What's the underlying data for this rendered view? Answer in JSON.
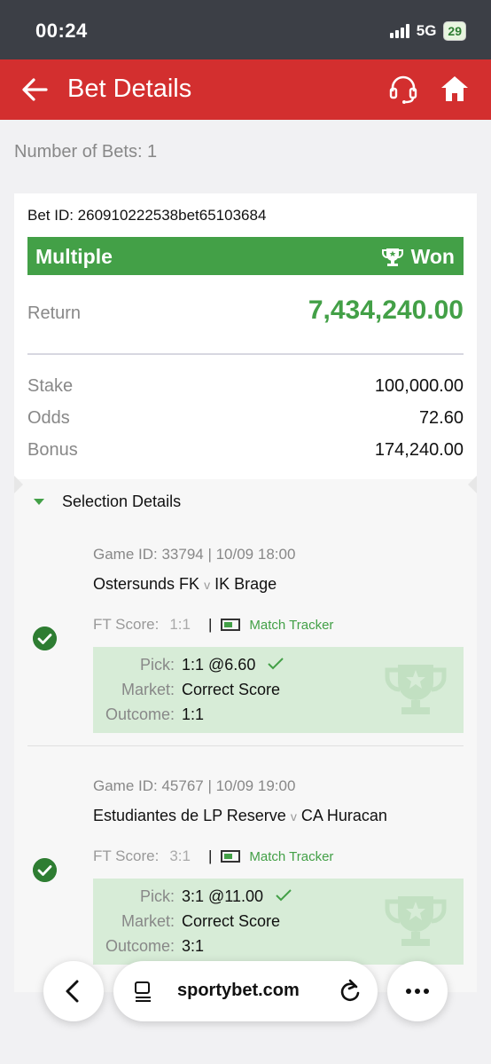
{
  "status_bar": {
    "time": "00:24",
    "network": "5G",
    "battery": "29"
  },
  "header": {
    "title": "Bet Details"
  },
  "summary": {
    "number_of_bets": "Number of Bets: 1"
  },
  "bet": {
    "bet_id": "Bet ID: 260910222538bet65103684",
    "type": "Multiple",
    "status": "Won",
    "return_label": "Return",
    "return_value": "7,434,240.00",
    "stake_label": "Stake",
    "stake_value": "100,000.00",
    "odds_label": "Odds",
    "odds_value": "72.60",
    "bonus_label": "Bonus",
    "bonus_value": "174,240.00"
  },
  "selection_details": {
    "title": "Selection Details",
    "items": [
      {
        "game": "Game ID: 33794 | 10/09 18:00",
        "home": "Ostersunds FK",
        "vs": "v",
        "away": "IK Brage",
        "ft_label": "FT Score:",
        "ft_score": "1:1",
        "separator": "|",
        "tracker": "Match Tracker",
        "pick_label": "Pick:",
        "pick_value": "1:1 @6.60",
        "market_label": "Market:",
        "market_value": "Correct Score",
        "outcome_label": "Outcome:",
        "outcome_value": "1:1"
      },
      {
        "game": "Game ID: 45767 | 10/09 19:00",
        "home": "Estudiantes de LP Reserve",
        "vs": "v",
        "away": "CA Huracan",
        "ft_label": "FT Score:",
        "ft_score": "3:1",
        "separator": "|",
        "tracker": "Match Tracker",
        "pick_label": "Pick:",
        "pick_value": "3:1 @11.00",
        "market_label": "Market:",
        "market_value": "Correct Score",
        "outcome_label": "Outcome:",
        "outcome_value": "3:1"
      }
    ]
  },
  "browser": {
    "url": "sportybet.com"
  },
  "colors": {
    "header_red": "#d32f2f",
    "win_green": "#43a047",
    "pick_bg": "#d7ecd7"
  },
  "icons": [
    "back-arrow-icon",
    "headset-icon",
    "home-icon",
    "trophy-icon",
    "caret-down-icon",
    "check-circle-icon",
    "checkmark-icon",
    "match-tracker-icon",
    "chevron-left-icon",
    "tabs-icon",
    "reload-icon",
    "more-icon"
  ]
}
